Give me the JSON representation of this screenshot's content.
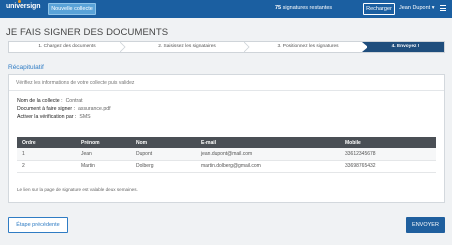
{
  "header": {
    "logo": "universign",
    "new_button": "Nouvelle collecte",
    "signatures_count": "75",
    "signatures_label": "signatures restantes",
    "recharge_button": "Recharger",
    "user": "Jean Dupont ▾",
    "menu_icon": "hamburger-icon",
    "brand_color": "#1b5fa1",
    "logo_dot_color": "#f39a1e"
  },
  "page": {
    "title": "JE FAIS SIGNER DES DOCUMENTS"
  },
  "steps": [
    {
      "label": "1. Chargez des documents",
      "active": false
    },
    {
      "label": "2. Saisissez les signataires",
      "active": false
    },
    {
      "label": "3. Positionnez les signatures",
      "active": false
    },
    {
      "label": "4. Envoyez !",
      "active": true
    }
  ],
  "recap": {
    "title": "Récapitulatif",
    "hint": "Vérifiez les informations de votre collecte puis validez",
    "fields": [
      {
        "label": "Nom de la collecte :",
        "value": "Contrat"
      },
      {
        "label": "Document à faire signer :",
        "value": "assurance.pdf"
      },
      {
        "label": "Activer la vérification par :",
        "value": "SMS"
      }
    ],
    "table": {
      "headers": [
        "Ordre",
        "Prénom",
        "Nom",
        "E-mail",
        "Mobile"
      ],
      "rows": [
        [
          "1",
          "Jean",
          "Dupont",
          "jean.dupont@mail.com",
          "33612345678"
        ],
        [
          "2",
          "Martin",
          "Dolberg",
          "martin.dolberg@gmail.com",
          "33698765432"
        ]
      ]
    },
    "note": "Le lien sur la page de signature est valable deux semaines."
  },
  "footer": {
    "prev_button": "Étape précédente",
    "send_button": "ENVOYER"
  }
}
